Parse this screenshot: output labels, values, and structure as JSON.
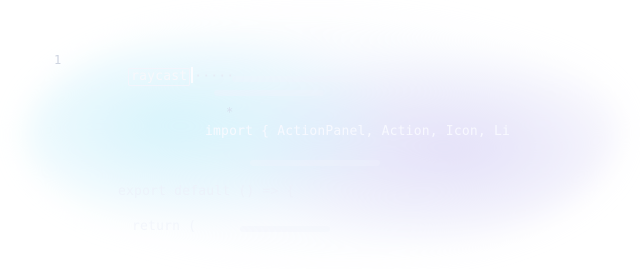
{
  "editor": {
    "line_number": "1",
    "line1": {
      "selected_word": "raycast",
      "trailing": "·····"
    },
    "asterisk": "*",
    "import_line": "import { ActionPanel, Action, Icon, Li",
    "line4": {
      "text": "export default () => {"
    },
    "line5": {
      "text": "return ("
    }
  }
}
